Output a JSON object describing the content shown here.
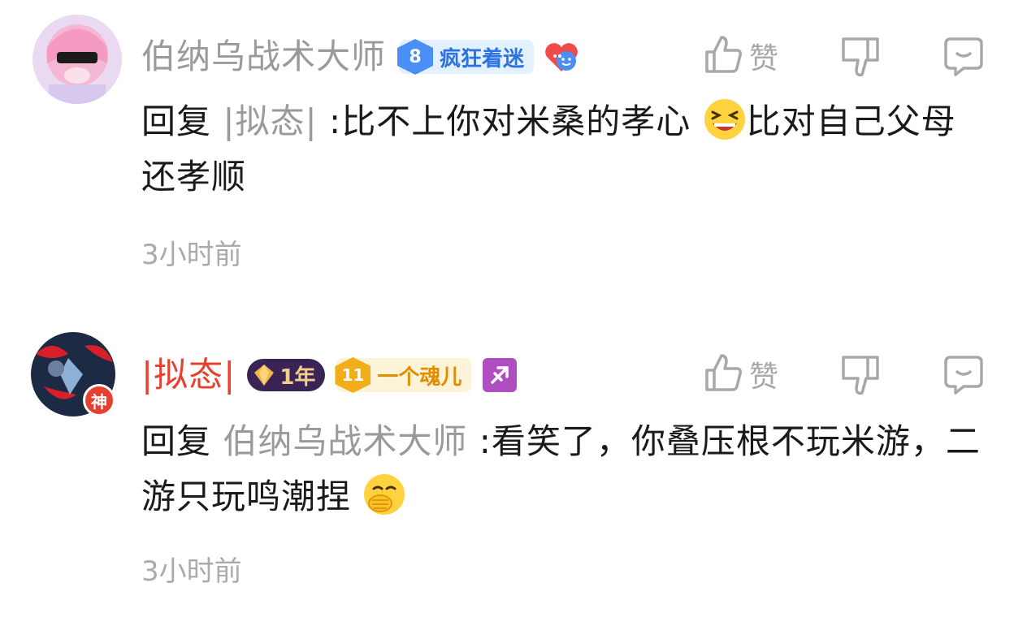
{
  "colors": {
    "text": "#1a1a1a",
    "muted": "#9a9a9a",
    "red_name": "#e8402f",
    "icon_gray": "#a8a8a8"
  },
  "comments": [
    {
      "username": "伯纳乌战术大师",
      "username_color": "#9a9a9a",
      "fan_badge": {
        "level": "8",
        "label": "疯狂着迷"
      },
      "extra_icon": "heart-face-emoji",
      "actions": {
        "like_label": "赞"
      },
      "reply_prefix": "回复",
      "mention": "|拟态|",
      "text_a": " :比不上你对米桑的孝心",
      "text_b": "比对自己父母还孝顺",
      "emoji": "laughing-squint-emoji",
      "time": "3小时前"
    },
    {
      "username": "|拟态|",
      "username_color": "#e8402f",
      "vip_badge": {
        "label": "1年"
      },
      "level_badge": {
        "level": "11",
        "label": "一个魂儿"
      },
      "zodiac_icon": "sagittarius-icon",
      "avatar_badge": "神",
      "actions": {
        "like_label": "赞"
      },
      "reply_prefix": "回复",
      "mention": "伯纳乌战术大师",
      "text_a": " :看笑了，你叠压根不玩米游，二游只玩鸣潮捏",
      "emoji": "hand-over-mouth-emoji",
      "time": "3小时前"
    }
  ]
}
